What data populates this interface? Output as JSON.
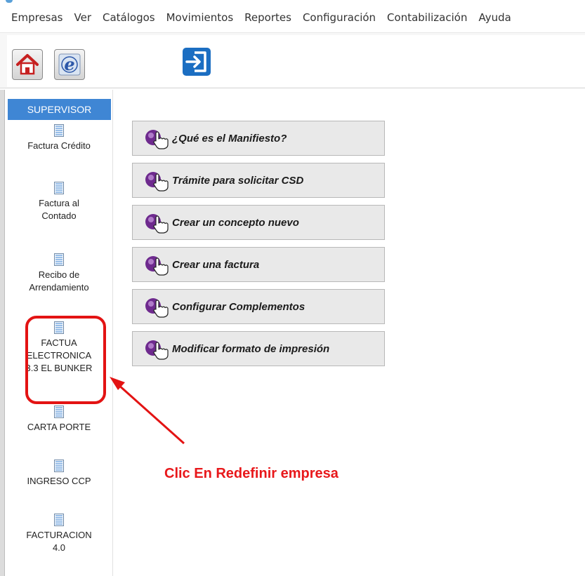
{
  "menu": [
    "Empresas",
    "Ver",
    "Catálogos",
    "Movimientos",
    "Reportes",
    "Configuración",
    "Contabilización",
    "Ayuda"
  ],
  "toolbar": {
    "buttons": [
      {
        "name": "home-button",
        "icon": "home-icon"
      },
      {
        "name": "e-button",
        "icon": "e-letter-icon"
      },
      {
        "name": "exit-button",
        "icon": "exit-door-icon"
      }
    ]
  },
  "sidebar": {
    "header": "SUPERVISOR",
    "items": [
      {
        "label": "Factura Crédito",
        "icon": "document-list-icon"
      },
      {
        "label": "Factura al\nContado",
        "icon": "document-list-icon"
      },
      {
        "label": "Recibo de\nArrendamiento",
        "icon": "document-list-icon"
      },
      {
        "label": "FACTUA\nELECTRONICA\n3.3 EL BUNKER",
        "icon": "document-list-icon"
      },
      {
        "label": "CARTA PORTE",
        "icon": "document-list-icon"
      },
      {
        "label": "INGRESO CCP",
        "icon": "document-list-icon"
      },
      {
        "label": "FACTURACION\n4.0",
        "icon": "document-list-icon"
      }
    ]
  },
  "main": {
    "buttons": [
      {
        "label": "¿Qué es el Manifiesto?",
        "icon": "hand-pointer-icon"
      },
      {
        "label": "Trámite para solicitar CSD",
        "icon": "hand-pointer-icon"
      },
      {
        "label": "Crear un concepto nuevo",
        "icon": "hand-pointer-icon"
      },
      {
        "label": "Crear una factura",
        "icon": "hand-pointer-icon"
      },
      {
        "label": "Configurar Complementos",
        "icon": "hand-pointer-icon"
      },
      {
        "label": "Modificar formato de impresión",
        "icon": "hand-pointer-icon"
      }
    ]
  },
  "annotation": {
    "text": "Clic En Redefinir empresa",
    "color": "#e8181b"
  },
  "colors": {
    "sidebar_header_bg": "#3f86d4",
    "highlight": "#e31313"
  }
}
